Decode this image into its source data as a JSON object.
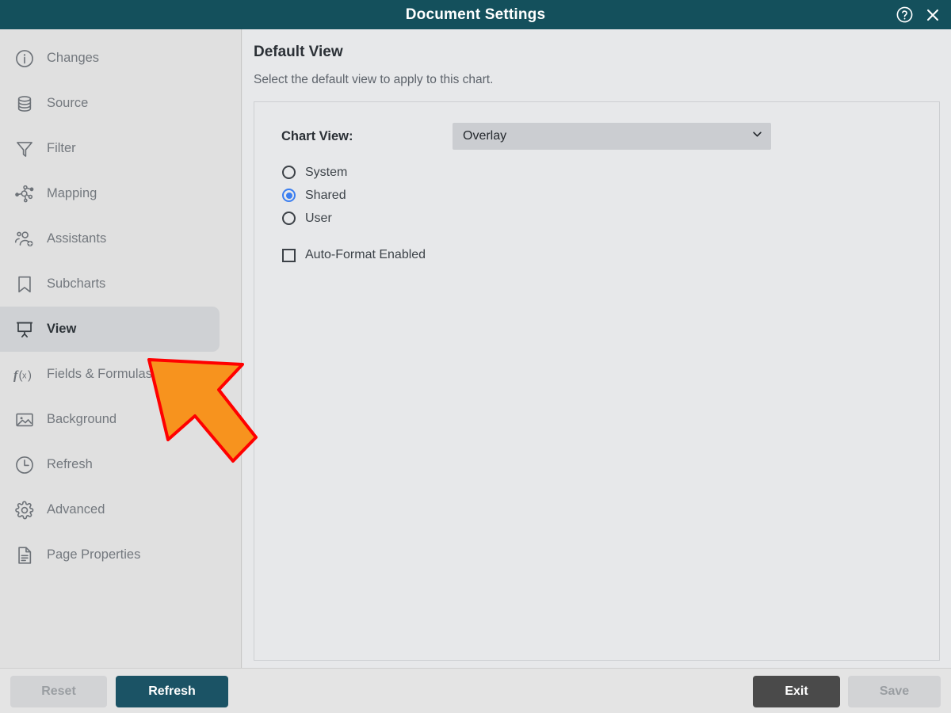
{
  "window": {
    "title": "Document Settings",
    "help_icon": "help-circle-icon",
    "close_icon": "close-icon",
    "titlebar_color": "#14505c"
  },
  "sidebar": {
    "items": [
      {
        "label": "Changes",
        "icon": "info-circle-icon",
        "active": false
      },
      {
        "label": "Source",
        "icon": "database-icon",
        "active": false
      },
      {
        "label": "Filter",
        "icon": "funnel-icon",
        "active": false
      },
      {
        "label": "Mapping",
        "icon": "node-graph-icon",
        "active": false
      },
      {
        "label": "Assistants",
        "icon": "users-add-icon",
        "active": false
      },
      {
        "label": "Subcharts",
        "icon": "bookmark-icon",
        "active": false
      },
      {
        "label": "View",
        "icon": "presentation-icon",
        "active": true
      },
      {
        "label": "Fields & Formulas",
        "icon": "function-icon",
        "active": false
      },
      {
        "label": "Background",
        "icon": "image-icon",
        "active": false
      },
      {
        "label": "Refresh",
        "icon": "clock-icon",
        "active": false
      },
      {
        "label": "Advanced",
        "icon": "gear-icon",
        "active": false
      },
      {
        "label": "Page Properties",
        "icon": "document-icon",
        "active": false
      }
    ]
  },
  "main": {
    "heading": "Default View",
    "description": "Select the default view to apply to this chart.",
    "chart_view": {
      "label": "Chart View:",
      "selected": "Overlay",
      "options": [
        "Overlay"
      ],
      "chevron_icon": "chevron-down-icon"
    },
    "scope_radios": [
      {
        "label": "System",
        "selected": false
      },
      {
        "label": "Shared",
        "selected": true
      },
      {
        "label": "User",
        "selected": false
      }
    ],
    "auto_format": {
      "label": "Auto-Format Enabled",
      "checked": false
    },
    "accent_color": "#3b7ef0"
  },
  "footer": {
    "reset_label": "Reset",
    "refresh_label": "Refresh",
    "exit_label": "Exit",
    "save_label": "Save",
    "primary_color": "#1b5365"
  },
  "annotation": {
    "type": "arrow-pointer",
    "points_to": "View",
    "fill_color": "#F7931E",
    "stroke_color": "#FF0000"
  }
}
